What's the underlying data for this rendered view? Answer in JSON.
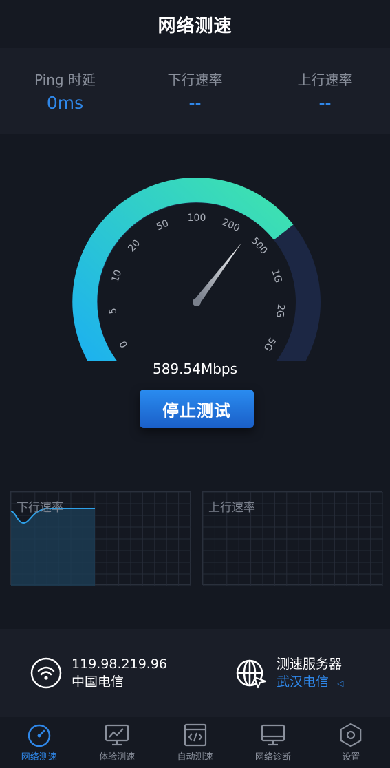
{
  "header": {
    "title": "网络测速"
  },
  "stats": [
    {
      "label": "Ping 时延",
      "value": "0ms"
    },
    {
      "label": "下行速率",
      "value": "--"
    },
    {
      "label": "上行速率",
      "value": "--"
    }
  ],
  "gauge": {
    "ticks": [
      "0",
      "5",
      "10",
      "20",
      "50",
      "100",
      "200",
      "500",
      "1G",
      "2G",
      "5G"
    ],
    "current_speed": "589.54Mbps",
    "stop_label": "停止测试",
    "fill_fraction": 0.7,
    "colors": {
      "fill_start": "#1fb0ef",
      "fill_end": "#3de3b0",
      "track": "#1c2744"
    }
  },
  "charts": {
    "down_label": "下行速率",
    "up_label": "上行速率"
  },
  "info": {
    "ip": "119.98.219.96",
    "isp": "中国电信",
    "server_title": "测速服务器",
    "server_name": "武汉电信"
  },
  "tabs": [
    {
      "label": "网络测速",
      "icon": "speedometer-icon",
      "active": true
    },
    {
      "label": "体验测速",
      "icon": "monitor-chart-icon",
      "active": false
    },
    {
      "label": "自动测速",
      "icon": "code-window-icon",
      "active": false
    },
    {
      "label": "网络诊断",
      "icon": "monitor-icon",
      "active": false
    },
    {
      "label": "设置",
      "icon": "hexagon-gear-icon",
      "active": false
    }
  ],
  "accent": "#2f87e8"
}
